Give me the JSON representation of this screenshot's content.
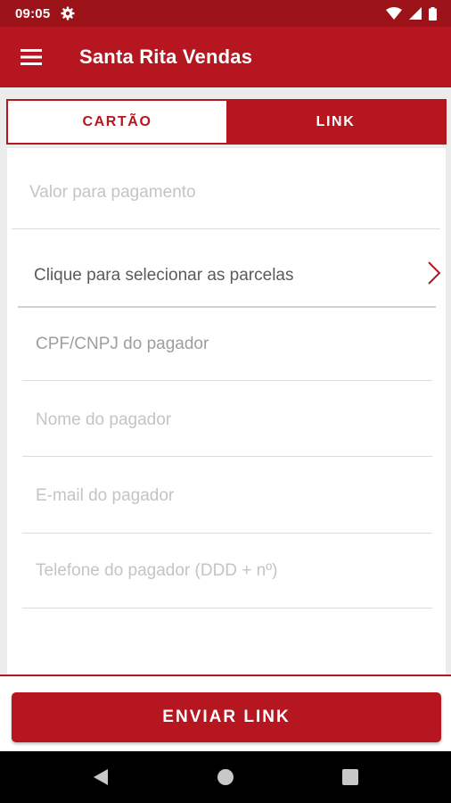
{
  "status_bar": {
    "time": "09:05",
    "icons": [
      "gear-icon",
      "wifi-icon",
      "signal-icon",
      "battery-icon"
    ]
  },
  "app_bar": {
    "menu_icon": "hamburger-icon",
    "title": "Santa Rita Vendas"
  },
  "tabs": [
    {
      "label": "CARTÃO",
      "selected": false
    },
    {
      "label": "LINK",
      "selected": true
    }
  ],
  "form": {
    "valor_placeholder": "Valor para pagamento",
    "parcelas_label": "Clique para selecionar as parcelas",
    "cpf_placeholder": "CPF/CNPJ do pagador",
    "nome_placeholder": "Nome do pagador",
    "email_placeholder": "E-mail do pagador",
    "telefone_placeholder": "Telefone do pagador (DDD + nº)"
  },
  "send_button": {
    "label": "ENVIAR LINK"
  },
  "nav_bar": {
    "icons": [
      "back-icon",
      "home-icon",
      "recents-icon"
    ]
  },
  "colors": {
    "primary": "#b5161f",
    "status_bar": "#9c1219"
  }
}
